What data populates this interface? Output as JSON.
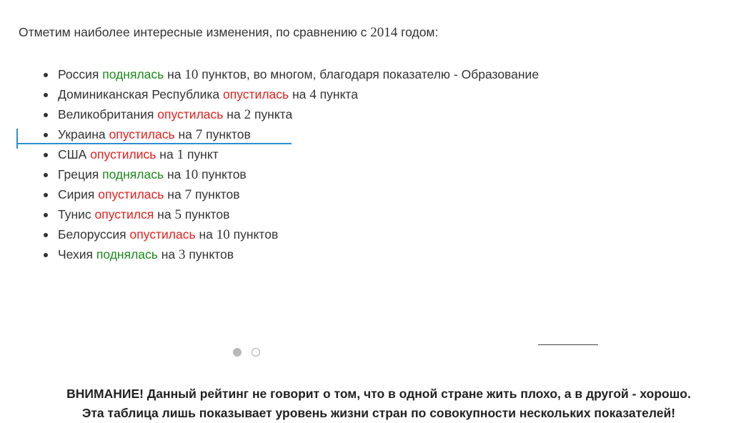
{
  "intro": {
    "before": "Отметим наиболее интересные изменения, по сравнению с",
    "year": "2014",
    "after": "годом:"
  },
  "changes": [
    {
      "country": "Россия",
      "verb": "поднялась",
      "direction": "up",
      "pre": "на",
      "amount": "10",
      "unit": "пунктов, во многом, благодаря показателю - Образование"
    },
    {
      "country": "Доминиканская Республика",
      "verb": "опустилась",
      "direction": "down",
      "pre": "на",
      "amount": "4",
      "unit": "пункта"
    },
    {
      "country": "Великобритания",
      "verb": "опустилась",
      "direction": "down",
      "pre": "на",
      "amount": "2",
      "unit": "пункта"
    },
    {
      "country": "Украина",
      "verb": "опустилась",
      "direction": "down",
      "pre": "на",
      "amount": "7",
      "unit": "пунктов"
    },
    {
      "country": "США",
      "verb": "опустились",
      "direction": "down",
      "pre": "на",
      "amount": "1",
      "unit": "пункт"
    },
    {
      "country": "Греция",
      "verb": "поднялась",
      "direction": "up",
      "pre": "на",
      "amount": "10",
      "unit": "пунктов"
    },
    {
      "country": "Сирия",
      "verb": "опустилась",
      "direction": "down",
      "pre": "на",
      "amount": "7",
      "unit": "пунктов"
    },
    {
      "country": "Тунис",
      "verb": "опустился",
      "direction": "down",
      "pre": "на",
      "amount": "5",
      "unit": "пунктов"
    },
    {
      "country": "Белоруссия",
      "verb": "опустилась",
      "direction": "down",
      "pre": "на",
      "amount": "10",
      "unit": "пунктов"
    },
    {
      "country": "Чехия",
      "verb": "поднялась",
      "direction": "up",
      "pre": "на",
      "amount": "3",
      "unit": "пунктов"
    }
  ],
  "colors": {
    "up": "#1a8a1a",
    "down": "#e5201d",
    "highlight": "#2a8fd4"
  },
  "carousel": {
    "pages": 2,
    "active_page": 1
  },
  "warning": {
    "line1": "ВНИМАНИЕ! Данный рейтинг не говорит о том, что в одной стране жить плохо, а в другой - хорошо.",
    "line2": "Эта таблица лишь показывает уровень жизни стран по совокупности нескольких показателей!"
  }
}
